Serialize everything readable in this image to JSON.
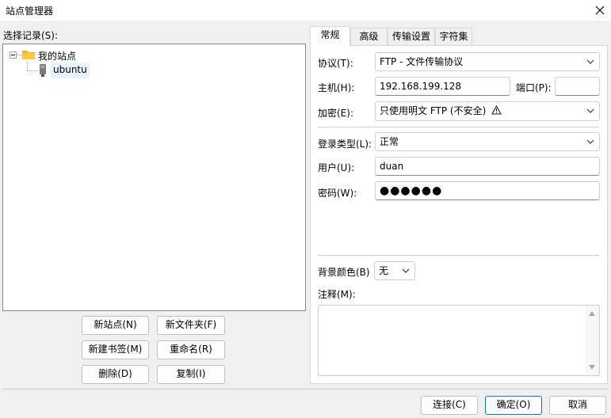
{
  "window": {
    "title": "站点管理器",
    "close_icon": "close-icon"
  },
  "left": {
    "select_label": "选择记录(S):",
    "tree": {
      "root_label": "我的站点",
      "root_icon": "folder-icon",
      "items": [
        {
          "label": "ubuntu",
          "icon": "server-icon",
          "selected": true
        }
      ]
    },
    "buttons": {
      "new_site": "新站点(N)",
      "new_folder": "新文件夹(F)",
      "new_bookmark": "新建书签(M)",
      "rename": "重命名(R)",
      "delete": "删除(D)",
      "duplicate": "复制(I)"
    }
  },
  "tabs": [
    {
      "label": "常规",
      "active": true
    },
    {
      "label": "高级",
      "active": false
    },
    {
      "label": "传输设置",
      "active": false
    },
    {
      "label": "字符集",
      "active": false
    }
  ],
  "general": {
    "protocol": {
      "label": "协议(T):",
      "value": "FTP - 文件传输协议"
    },
    "host": {
      "label": "主机(H):",
      "value": "192.168.199.128"
    },
    "port": {
      "label": "端口(P):",
      "value": ""
    },
    "encryption": {
      "label": "加密(E):",
      "value": "只使用明文 FTP (不安全)",
      "icon": "warning-icon"
    },
    "logon_type": {
      "label": "登录类型(L):",
      "value": "正常"
    },
    "user": {
      "label": "用户(U):",
      "value": "duan"
    },
    "password": {
      "label": "密码(W):",
      "value": "●●●●●●"
    },
    "background_color": {
      "label": "背景颜色(B)",
      "value": "无"
    },
    "comments": {
      "label": "注释(M):",
      "value": ""
    }
  },
  "footer": {
    "connect": "连接(C)",
    "ok": "确定(O)",
    "cancel": "取消"
  },
  "colors": {
    "accent": "#0078d4",
    "selection": "#e5f3ff",
    "folder": "#f0b430"
  }
}
